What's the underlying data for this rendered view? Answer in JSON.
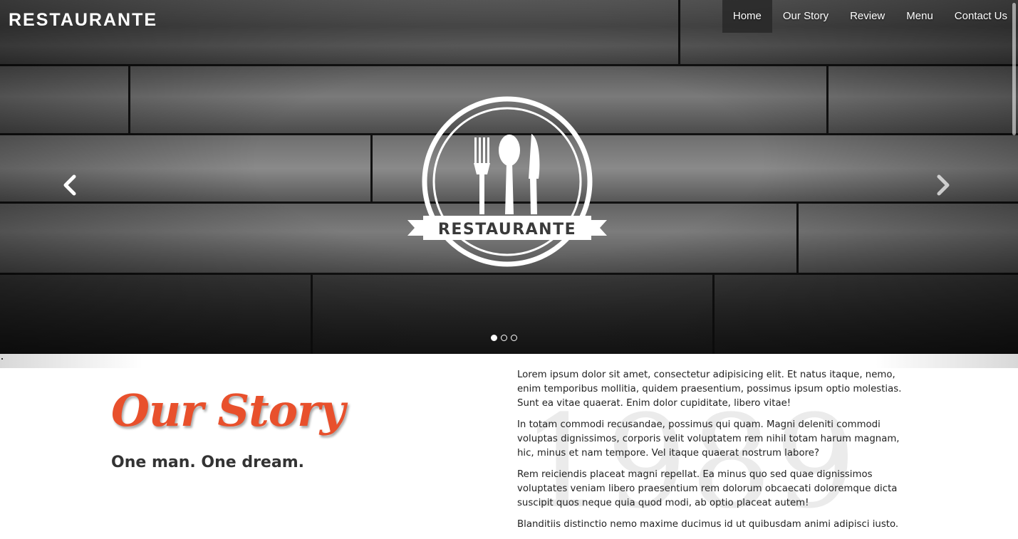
{
  "brand": "RESTAURANTE",
  "nav": {
    "items": [
      "Home",
      "Our Story",
      "Review",
      "Menu",
      "Contact Us"
    ],
    "active": "Home"
  },
  "hero": {
    "logo_text": "RESTAURANTE",
    "prev_icon": "chevron-left-icon",
    "next_icon": "chevron-right-icon",
    "slide_count": 3,
    "active_slide": 1
  },
  "story": {
    "heading": "Our Story",
    "subheading": "One man. One dream.",
    "year": "1989",
    "paragraphs": [
      "Lorem ipsum dolor sit amet, consectetur adipisicing elit. Et natus itaque, nemo, enim temporibus mollitia, quidem praesentium, possimus ipsum optio molestias. Sunt ea vitae quaerat. Enim dolor cupiditate, libero vitae!",
      "In totam commodi recusandae, possimus qui quam. Magni deleniti commodi voluptas dignissimos, corporis velit voluptatem rem nihil totam harum magnam, hic, minus et nam tempore. Vel itaque quaerat nostrum labore?",
      "Rem reiciendis placeat magni repellat. Ea minus quo sed quae dignissimos voluptates veniam libero praesentium rem dolorum obcaecati doloremque dicta suscipit quos neque quia quod modi, ab optio placeat autem!",
      "Blanditiis distinctio nemo maxime ducimus id ut quibusdam animi adipisci iusto."
    ]
  },
  "colors": {
    "accent": "#e8502c",
    "text": "#333333",
    "nav_active_bg": "#282828"
  }
}
